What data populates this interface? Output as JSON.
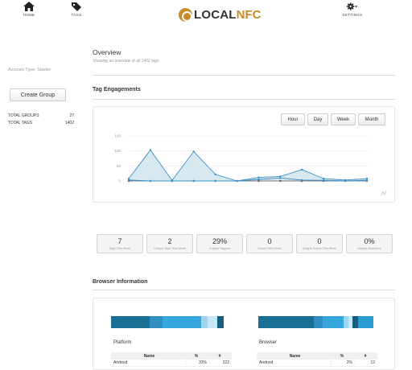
{
  "nav": {
    "home": {
      "label": "HOME",
      "icon": "home-icon"
    },
    "tags": {
      "label": "TAGS",
      "icon": "tag-icon"
    },
    "settings": {
      "label": "SETTINGS",
      "icon": "gear-icon"
    }
  },
  "logo": {
    "part1": "LOCAL",
    "part2": "NFC"
  },
  "sidebar": {
    "account_type": "Account Type: Starter",
    "create_group": "Create Group",
    "stats": [
      {
        "label": "TOTAL GROUPS",
        "value": "27"
      },
      {
        "label": "TOTAL TAGS",
        "value": "1402"
      }
    ]
  },
  "overview": {
    "title": "Overview",
    "subtitle": "Showing an overview of all 1402 tags"
  },
  "engagements": {
    "title": "Tag Engagements",
    "buttons": [
      "Hour",
      "Day",
      "Week",
      "Month"
    ]
  },
  "chart_data": {
    "type": "area",
    "yticks": [
      "150",
      "100",
      "50",
      "0"
    ],
    "ylim": [
      0,
      150
    ],
    "grid": true,
    "series": [
      {
        "values": [
          8,
          103,
          2,
          98,
          22,
          0,
          12,
          15,
          38,
          8,
          3,
          8
        ],
        "color": "#3b8fc4"
      },
      {
        "values": [
          0,
          0,
          0,
          0,
          0,
          0,
          0,
          0,
          0,
          0,
          0,
          0
        ],
        "color": "#555555"
      },
      {
        "values": [
          3,
          0,
          0,
          0,
          0,
          0,
          5,
          10,
          3,
          2,
          0,
          2
        ],
        "color": "#3b8fc4"
      }
    ]
  },
  "kpis": [
    {
      "value": "7",
      "label": "Taps This Week"
    },
    {
      "value": "2",
      "label": "Unique Taps This Week"
    },
    {
      "value": "29%",
      "label": "Unique Tappers"
    },
    {
      "value": "0",
      "label": "Scans This Week"
    },
    {
      "value": "0",
      "label": "Unique Scans This Week"
    },
    {
      "value": "0%",
      "label": "Unique Scanners"
    }
  ],
  "browser_info": {
    "title": "Browser Information",
    "platform": {
      "title": "Platform",
      "headers": [
        "Name",
        "%",
        "#"
      ],
      "rows": [
        [
          "Android",
          "33%",
          "222"
        ]
      ],
      "bar": [
        {
          "frac": 0.34,
          "color": "#1a6f94"
        },
        {
          "frac": 0.12,
          "color": "#2f8fc2"
        },
        {
          "frac": 0.34,
          "color": "#35a7dc"
        },
        {
          "frac": 0.06,
          "color": "#9ed6f0"
        },
        {
          "frac": 0.08,
          "color": "#c7e8f7"
        },
        {
          "frac": 0.06,
          "color": "#155e80"
        }
      ]
    },
    "browser": {
      "title": "Browser",
      "headers": [
        "Name",
        "%",
        "#"
      ],
      "rows": [
        [
          "Android",
          "2%",
          "12"
        ]
      ],
      "bar": [
        {
          "frac": 0.48,
          "color": "#1a6f94"
        },
        {
          "frac": 0.08,
          "color": "#2f8fc2"
        },
        {
          "frac": 0.18,
          "color": "#35a7dc"
        },
        {
          "frac": 0.04,
          "color": "#9ed6f0"
        },
        {
          "frac": 0.04,
          "color": "#c7e8f7"
        },
        {
          "frac": 0.05,
          "color": "#155e80"
        },
        {
          "frac": 0.13,
          "color": "#2b9bd3"
        }
      ]
    }
  }
}
